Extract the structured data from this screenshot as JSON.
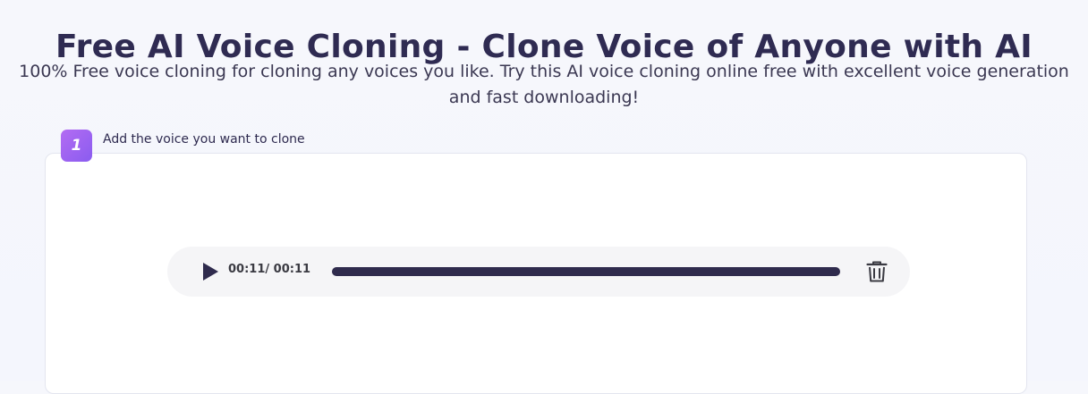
{
  "header": {
    "title": "Free AI Voice Cloning - Clone Voice of Anyone with AI",
    "subtitle": "100% Free voice cloning for cloning any voices you like. Try this AI voice cloning online free with excellent voice generation and fast downloading!"
  },
  "step1": {
    "number": "1",
    "label": "Add the voice you want to clone"
  },
  "audio_player": {
    "time": "00:11/ 00:11",
    "progress_fraction": 1.0,
    "play_icon": "play-icon",
    "delete_icon": "trash-icon"
  },
  "colors": {
    "accent_start": "#b36cf2",
    "accent_end": "#8a5cf0",
    "title": "#2f2b52",
    "progress": "#2f2b4d"
  }
}
